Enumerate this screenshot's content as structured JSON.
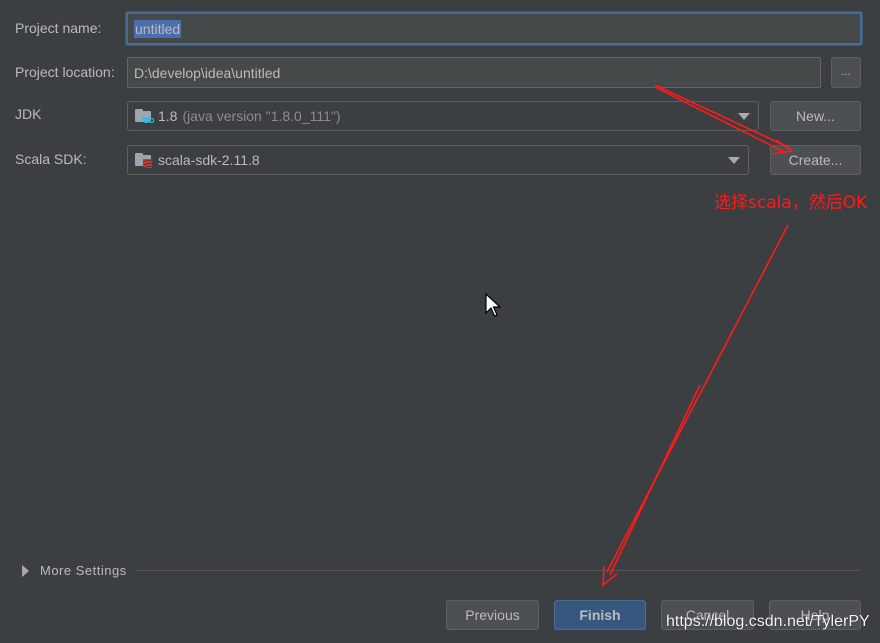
{
  "form": {
    "project_name_label": "Project name:",
    "project_name_value": "untitled",
    "project_location_label": "Project location:",
    "project_location_value": "D:\\develop\\idea\\untitled",
    "browse_button_label": "...",
    "jdk_label": "JDK",
    "jdk_version": "1.8",
    "jdk_detail": "(java version \"1.8.0_111\")",
    "jdk_new_button_label": "New...",
    "scala_sdk_label": "Scala SDK:",
    "scala_sdk_value": "scala-sdk-2.11.8",
    "scala_create_button_label": "Create..."
  },
  "more_settings": {
    "label": "More Settings",
    "expanded": false
  },
  "footer": {
    "previous_label": "Previous",
    "finish_label": "Finish",
    "cancel_label": "Cancel",
    "help_label": "Help"
  },
  "annotation": {
    "text": "选择scala，然后OK",
    "color": "#ff1a1a"
  },
  "watermark": {
    "text": "https://blog.csdn.net/TylerPY"
  },
  "colors": {
    "background": "#3c3f41",
    "field_background": "#45494a",
    "focus_border": "#466d94",
    "selection": "#4b6eaf",
    "primary_button": "#365880",
    "jdk_icon_accent": "#40b6e0",
    "scala_icon_accent": "#de3423"
  }
}
